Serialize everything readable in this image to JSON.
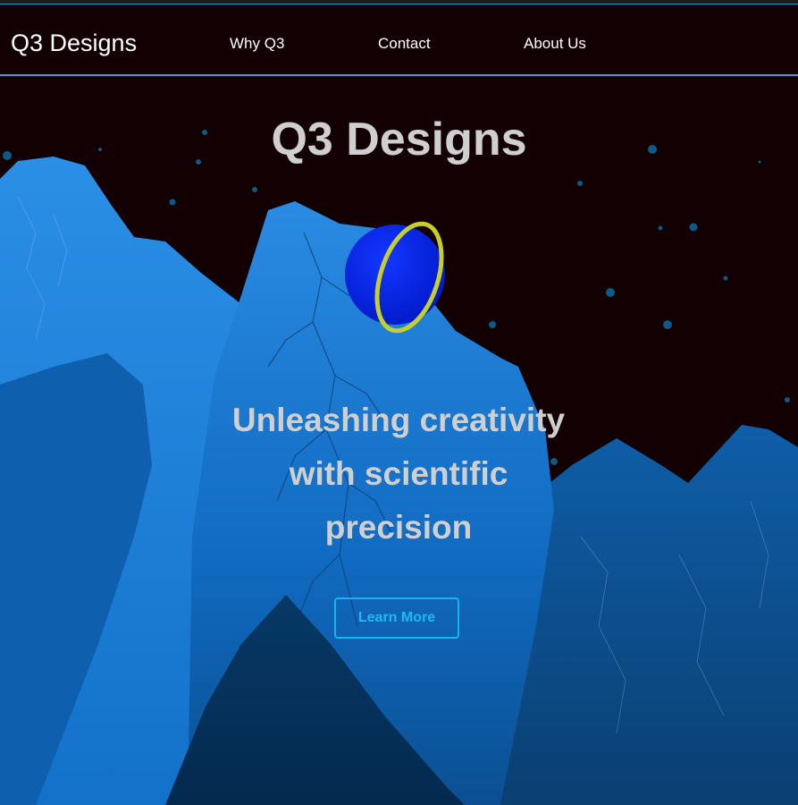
{
  "nav": {
    "brand": "Q3 Designs",
    "links": [
      {
        "label": "Why Q3"
      },
      {
        "label": "Contact"
      },
      {
        "label": "About Us"
      }
    ]
  },
  "hero": {
    "title": "Q3 Designs",
    "tagline_lines": [
      "Unleashing creativity",
      "with scientific",
      "precision"
    ],
    "cta_label": "Learn More"
  },
  "colors": {
    "background": "#120003",
    "nav_border": "#2ea1d8",
    "heading_text": "#cfcfcf",
    "cta_accent": "#19b2f2",
    "planet": "#0a2bff",
    "planet_ring": "#c6cf2a",
    "mountain_light": "#1f8fe8",
    "mountain_dark": "#0a4c86"
  },
  "icons": [
    "star-icon",
    "planet-icon"
  ]
}
